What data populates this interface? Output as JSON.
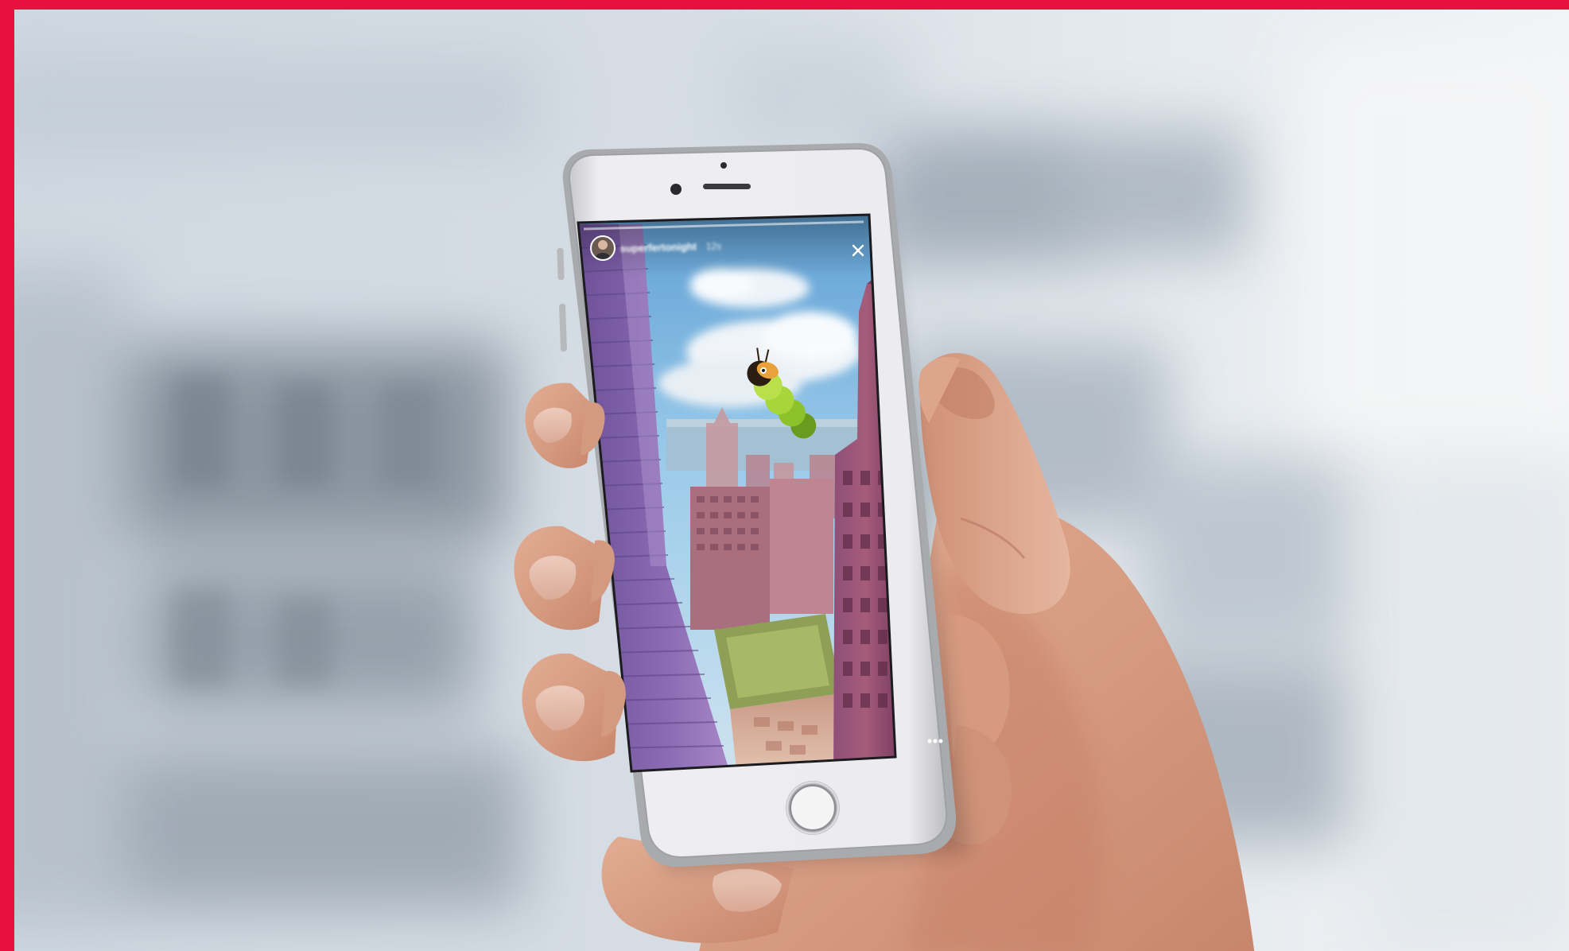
{
  "colors": {
    "accent": "#e8103f",
    "background": "#dde4ea",
    "phone_body": "#e9e9eb",
    "skin": "#d9a086"
  },
  "photo": {
    "subject": "hand holding smartphone showing an Instagram story"
  },
  "story": {
    "username": "superfertonight",
    "time_ago": "12s",
    "sticker": "caterpillar-sticker"
  },
  "icons": {
    "close": "close-icon",
    "more": "more-options-icon",
    "avatar": "avatar",
    "home_button": "home-button"
  }
}
